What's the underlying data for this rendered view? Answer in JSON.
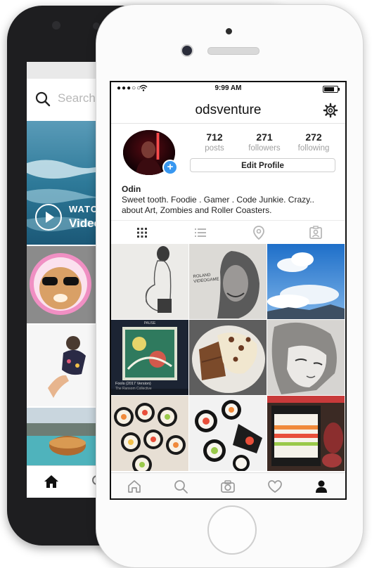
{
  "back_phone": {
    "search": {
      "placeholder": "Search"
    },
    "video_tile": {
      "watch_label": "WATCH",
      "title": "Video"
    }
  },
  "status_bar": {
    "carrier": "●●●○○",
    "time": "9:99 AM",
    "battery_level": 0.85
  },
  "profile": {
    "username": "odsventure",
    "stats": [
      {
        "value": "712",
        "label": "posts"
      },
      {
        "value": "271",
        "label": "followers"
      },
      {
        "value": "272",
        "label": "following"
      }
    ],
    "edit_button": "Edit Profile",
    "add_badge": "+",
    "bio_name": "Odin",
    "bio_line1": "Sweet tooth. Foodie . Gamer . Code Junkie. Crazy..",
    "bio_line2": "about Art, Zombies and Roller Coasters."
  },
  "view_tabs": [
    {
      "icon": "grid-icon",
      "active": true
    },
    {
      "icon": "list-icon",
      "active": false
    },
    {
      "icon": "location-pin-icon",
      "active": false
    },
    {
      "icon": "tagged-person-icon",
      "active": false
    }
  ],
  "grid_posts": [
    {
      "subject": "pencil sketch of pregnant woman"
    },
    {
      "subject": "pencil sketch of man in hood"
    },
    {
      "subject": "blue sky with clouds"
    },
    {
      "subject": "album cover"
    },
    {
      "subject": "brownies with cream"
    },
    {
      "subject": "anime girl sketch"
    },
    {
      "subject": "sushi rolls"
    },
    {
      "subject": "sushi rolls"
    },
    {
      "subject": "sushi making"
    }
  ],
  "album_cover": {
    "top_text": "PAUSE",
    "title": "Fools (2017 Version)",
    "artist": "The Ransom Collective"
  },
  "sketch_caption": "ROLAND VIDEOGAME",
  "bottom_nav": [
    {
      "icon": "home-icon",
      "active": false
    },
    {
      "icon": "search-icon",
      "active": false
    },
    {
      "icon": "camera-icon",
      "active": false
    },
    {
      "icon": "heart-icon",
      "active": false
    },
    {
      "icon": "profile-icon",
      "active": true
    }
  ],
  "colors": {
    "accent_blue": "#3897f0",
    "text_dark": "#222222",
    "text_muted": "#a0a0a0",
    "icon_inactive": "#9a9a9a"
  }
}
